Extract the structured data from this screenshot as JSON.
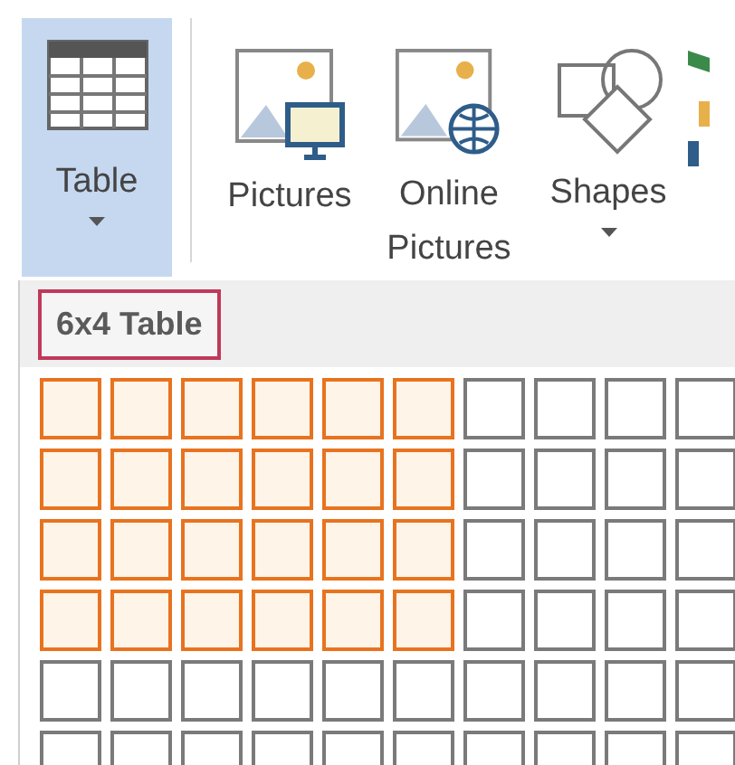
{
  "ribbon": {
    "buttons": [
      {
        "kind": "table",
        "label": "Table",
        "selected": true,
        "dropdown": true
      },
      {
        "kind": "pictures",
        "label": "Pictures",
        "selected": false,
        "dropdown": false
      },
      {
        "kind": "online",
        "label": "Online Pictures",
        "selected": false,
        "dropdown": false
      },
      {
        "kind": "shapes",
        "label": "Shapes",
        "selected": false,
        "dropdown": true
      }
    ]
  },
  "insert_table": {
    "heading": "6x4 Table",
    "rows": [
      {
        "cells": [
          {
            "selected": true
          },
          {
            "selected": true
          },
          {
            "selected": true
          },
          {
            "selected": true
          },
          {
            "selected": true
          },
          {
            "selected": true
          },
          {
            "selected": false
          },
          {
            "selected": false
          },
          {
            "selected": false
          },
          {
            "selected": false
          }
        ]
      },
      {
        "cells": [
          {
            "selected": true
          },
          {
            "selected": true
          },
          {
            "selected": true
          },
          {
            "selected": true
          },
          {
            "selected": true
          },
          {
            "selected": true
          },
          {
            "selected": false
          },
          {
            "selected": false
          },
          {
            "selected": false
          },
          {
            "selected": false
          }
        ]
      },
      {
        "cells": [
          {
            "selected": true
          },
          {
            "selected": true
          },
          {
            "selected": true
          },
          {
            "selected": true
          },
          {
            "selected": true
          },
          {
            "selected": true
          },
          {
            "selected": false
          },
          {
            "selected": false
          },
          {
            "selected": false
          },
          {
            "selected": false
          }
        ]
      },
      {
        "cells": [
          {
            "selected": true
          },
          {
            "selected": true
          },
          {
            "selected": true
          },
          {
            "selected": true
          },
          {
            "selected": true
          },
          {
            "selected": true
          },
          {
            "selected": false
          },
          {
            "selected": false
          },
          {
            "selected": false
          },
          {
            "selected": false
          }
        ]
      },
      {
        "cells": [
          {
            "selected": false
          },
          {
            "selected": false
          },
          {
            "selected": false
          },
          {
            "selected": false
          },
          {
            "selected": false
          },
          {
            "selected": false
          },
          {
            "selected": false
          },
          {
            "selected": false
          },
          {
            "selected": false
          },
          {
            "selected": false
          }
        ]
      },
      {
        "cells": [
          {
            "selected": false
          },
          {
            "selected": false
          },
          {
            "selected": false
          },
          {
            "selected": false
          },
          {
            "selected": false
          },
          {
            "selected": false
          },
          {
            "selected": false
          },
          {
            "selected": false
          },
          {
            "selected": false
          },
          {
            "selected": false
          }
        ]
      }
    ]
  }
}
